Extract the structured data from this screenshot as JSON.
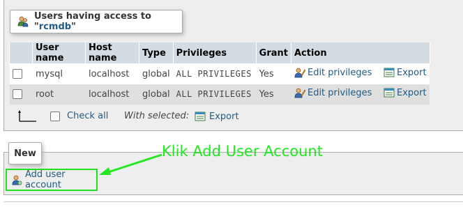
{
  "users_panel": {
    "title_prefix": "Users having access to \"",
    "db_name": "rcmdb",
    "title_suffix": "\"",
    "columns": [
      "",
      "User name",
      "Host name",
      "Type",
      "Privileges",
      "Grant",
      "Action"
    ],
    "rows": [
      {
        "user": "mysql",
        "host": "localhost",
        "type": "global",
        "privileges": "ALL PRIVILEGES",
        "grant": "Yes",
        "edit_label": "Edit privileges",
        "export_label": "Export"
      },
      {
        "user": "root",
        "host": "localhost",
        "type": "global",
        "privileges": "ALL PRIVILEGES",
        "grant": "Yes",
        "edit_label": "Edit privileges",
        "export_label": "Export"
      }
    ],
    "check_all_label": "Check all",
    "with_selected_label": "With selected:",
    "export_label": "Export"
  },
  "new_panel": {
    "title": "New",
    "add_user_label": "Add user account"
  },
  "annotation": {
    "text": "Klik Add User Account",
    "color": "#22e822"
  },
  "colors": {
    "link": "#235a81",
    "header_bg": "#d3dce3",
    "panel_bg": "#eeeeee"
  }
}
